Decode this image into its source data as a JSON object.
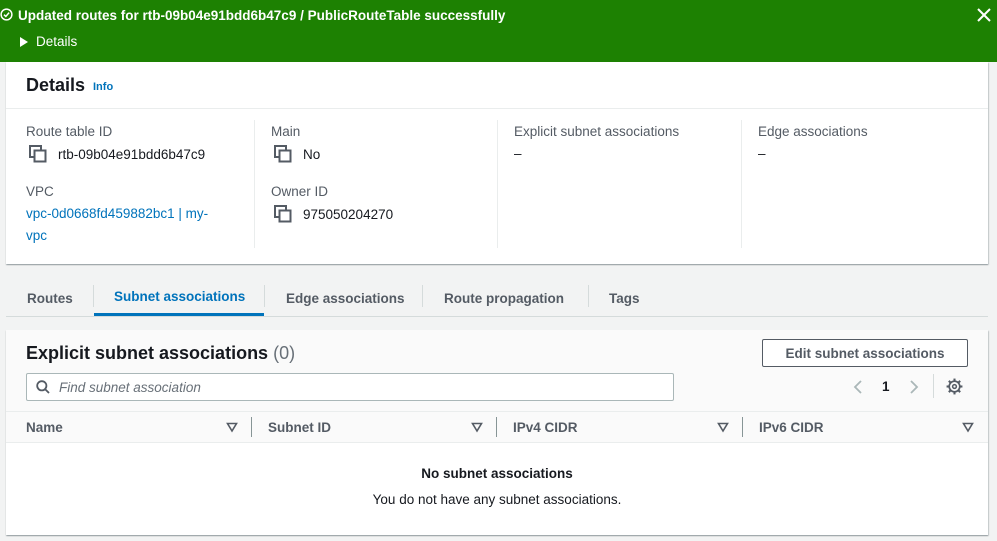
{
  "flash": {
    "message": "Updated routes for rtb-09b04e91bdd6b47c9 / PublicRouteTable successfully",
    "details_label": "Details",
    "status_icon": "success-check-icon",
    "close_icon": "close-icon",
    "color": "#1d8102"
  },
  "details": {
    "title": "Details",
    "info_label": "Info",
    "route_table_id": {
      "label": "Route table ID",
      "value": "rtb-09b04e91bdd6b47c9"
    },
    "main": {
      "label": "Main",
      "value": "No"
    },
    "explicit_subnet_associations": {
      "label": "Explicit subnet associations",
      "value": "–"
    },
    "edge_associations": {
      "label": "Edge associations",
      "value": "–"
    },
    "vpc": {
      "label": "VPC",
      "value_line1": "vpc-0d0668fd459882bc1 | my-",
      "value_line2": "vpc"
    },
    "owner_id": {
      "label": "Owner ID",
      "value": "975050204270"
    }
  },
  "tabs": [
    {
      "label": "Routes",
      "active": false
    },
    {
      "label": "Subnet associations",
      "active": true
    },
    {
      "label": "Edge associations",
      "active": false
    },
    {
      "label": "Route propagation",
      "active": false
    },
    {
      "label": "Tags",
      "active": false
    }
  ],
  "subnet_assoc": {
    "title": "Explicit subnet associations",
    "count": "(0)",
    "edit_button": "Edit subnet associations",
    "search_placeholder": "Find subnet association",
    "page": "1",
    "columns": [
      "Name",
      "Subnet ID",
      "IPv4 CIDR",
      "IPv6 CIDR"
    ],
    "empty_title": "No subnet associations",
    "empty_desc": "You do not have any subnet associations."
  },
  "colors": {
    "accent": "#0073bb",
    "success": "#1d8102",
    "text": "#16191f",
    "muted": "#545b64"
  }
}
